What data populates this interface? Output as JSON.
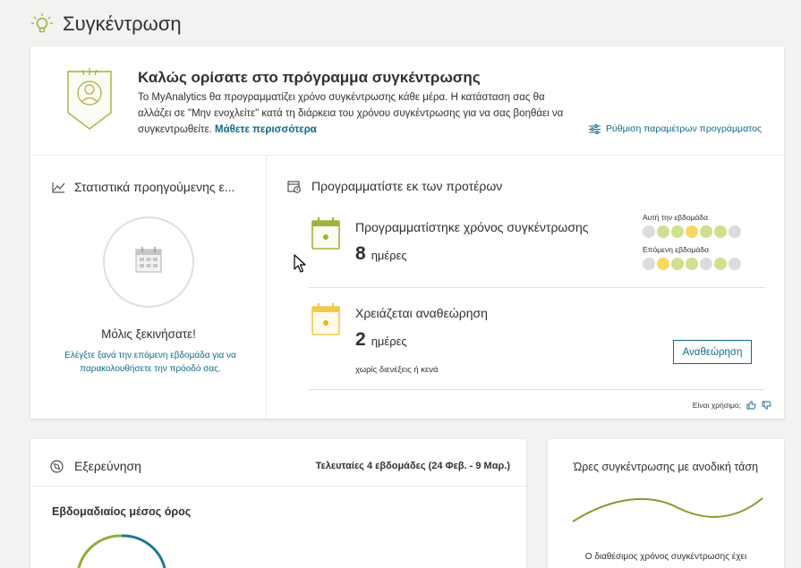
{
  "page": {
    "title": "Συγκέντρωση",
    "icon": "lightbulb-icon"
  },
  "welcome": {
    "title": "Καλώς ορίσατε στο πρόγραμμα συγκέντρωσης",
    "text": "Το MyAnalytics θα προγραμματίζει χρόνο συγκέντρωσης κάθε μέρα. Η κατάσταση σας θα αλλάζει σε \"Μην ενοχλείτε\" κατά τη διάρκεια του χρόνου συγκέντρωσης για να σας βοηθάει να συγκεντρωθείτε.",
    "learn_more": "Μάθετε περισσότερα",
    "settings_link": "Ρύθμιση παραμέτρων προγράμματος"
  },
  "stats": {
    "heading": "Στατιστικά προηγούμενης ε...",
    "empty_title": "Μόλις ξεκινήσατε!",
    "empty_text": "Ελέγξτε ξανά την επόμενη εβδομάδα για να παρακολουθήσετε την πρόοδό σας."
  },
  "plan": {
    "heading": "Προγραμματίστε εκ των προτέρων",
    "scheduled": {
      "title": "Προγραμματίστηκε χρόνος συγκέντρωσης",
      "count": "8",
      "unit": "ημέρες",
      "this_week_label": "Αυτή την εβδομάδα",
      "next_week_label": "Επόμενη εβδομάδα",
      "this_week": [
        "gray",
        "green",
        "green",
        "yellow",
        "green",
        "green",
        "gray"
      ],
      "next_week": [
        "gray",
        "yellow",
        "green",
        "green",
        "gray",
        "green",
        "gray"
      ]
    },
    "review": {
      "title": "Χρειάζεται αναθεώρηση",
      "count": "2",
      "unit": "ημέρες",
      "note": "χωρίς διενέξεις ή κενά",
      "button": "Αναθεώρηση"
    },
    "helpful": "Είναι χρήσιμο;"
  },
  "explore": {
    "heading": "Εξερεύνηση",
    "range": "Τελευταίες 4 εβδομάδες (24 Φεβ. - 9 Μαρ.)",
    "subheading": "Εβδομαδιαίος μέσος όρος"
  },
  "trend": {
    "title": "Ώρες συγκέντρωσης με ανοδική τάση",
    "note": "Ο διαθέσιμος χρόνος συγκέντρωσης έχει"
  },
  "colors": {
    "accent": "#106b8a",
    "green": "#9bb53e",
    "dot_gray": "#dcdcdc",
    "dot_green": "#cfe08e",
    "dot_yellow": "#fad763",
    "yellow": "#f2c94c"
  }
}
